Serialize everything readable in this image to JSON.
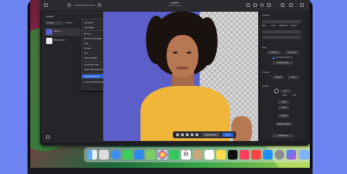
{
  "window": {
    "title": "Jayden",
    "subtitle": "Pixelmator Pro"
  },
  "layers_panel": {
    "header": "Layers",
    "blend_mode": "Normal",
    "opacity_label": "Opacity",
    "layers": [
      {
        "name": "Jayden"
      },
      {
        "name": "Background"
      }
    ]
  },
  "context_menu": {
    "items": [
      {
        "label": "Add Mask",
        "submenu": false,
        "highlighted": false
      },
      {
        "label": "Add Shape",
        "submenu": false,
        "highlighted": false
      },
      {
        "label": "Remove",
        "submenu": false,
        "highlighted": false
      },
      {
        "label": "Reverse Rectangle",
        "submenu": false,
        "highlighted": false
      },
      {
        "label": "Oval",
        "submenu": false,
        "highlighted": false
      },
      {
        "label": "Polygon",
        "submenu": false,
        "highlighted": false
      },
      {
        "label": "Star",
        "submenu": false,
        "highlighted": false
      },
      {
        "label": "Custom Shape",
        "submenu": true,
        "highlighted": false
      },
      {
        "label": "Group With Item",
        "submenu": false,
        "highlighted": false
      },
      {
        "label": "Clear With Mask Item",
        "submenu": false,
        "highlighted": false
      },
      {
        "label": "Add Background",
        "submenu": false,
        "highlighted": true
      },
      {
        "label": "Custom Masking Mask",
        "submenu": false,
        "highlighted": false
      }
    ]
  },
  "float_bar": {
    "cancel_label": "Cancel/Undo",
    "done_label": "Done"
  },
  "inspector": {
    "arrange_label": "Arrange",
    "arrange_buttons": [
      "Back",
      "Front",
      "Backward",
      "Forward"
    ],
    "size_label": "Size",
    "width": "1769 px",
    "height": "1771 px",
    "constrain_label": "Constrain proportions",
    "original_size_label": "Original Size",
    "position_label": "Position",
    "x_value": "123 px",
    "y_value": "0 px",
    "rotate_label": "Rotate",
    "angle_value": "0°",
    "angle_label": "Angle",
    "flip_label": "Flip",
    "lock_label": "Lock",
    "hide_label": "Hide",
    "group_label": "Group",
    "merge_label": "Merge Layers",
    "transform_label": "Transform"
  },
  "dock": {
    "calendar_month": "JUL",
    "calendar_day": "23"
  },
  "colors": {
    "accent": "#2f63d8",
    "background": "#6e83f2",
    "shirt": "#f0b63a"
  }
}
